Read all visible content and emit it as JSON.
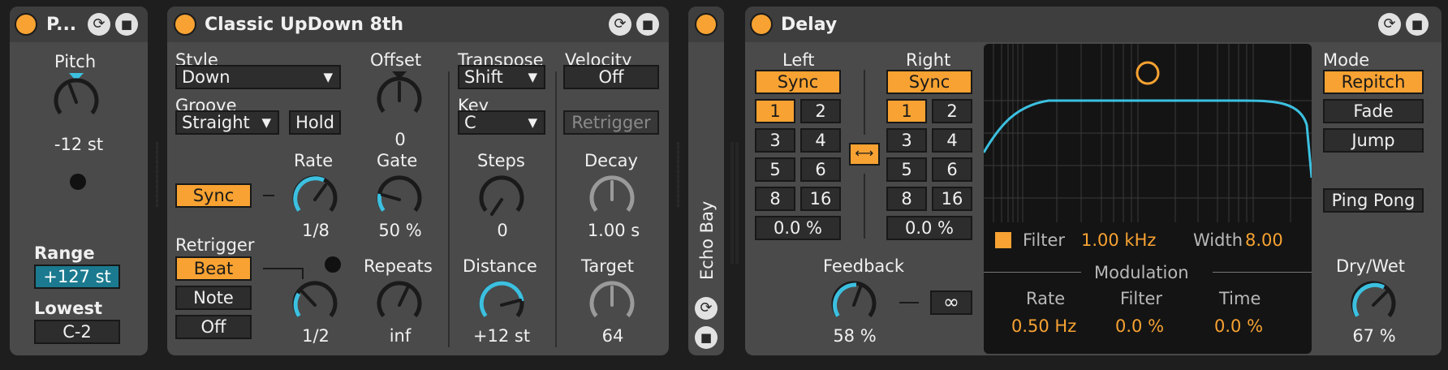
{
  "pitch_device": {
    "title": "P...",
    "pitch_label": "Pitch",
    "pitch_value": "-12 st",
    "range_label": "Range",
    "range_value": "+127 st",
    "lowest_label": "Lowest",
    "lowest_value": "C-2"
  },
  "arp_device": {
    "title": "Classic UpDown 8th",
    "style_label": "Style",
    "style_value": "Down",
    "groove_label": "Groove",
    "groove_value": "Straight",
    "hold_label": "Hold",
    "sync_label": "Sync",
    "rate_label": "Rate",
    "rate_value": "1/8",
    "offset_label": "Offset",
    "offset_value": "0",
    "gate_label": "Gate",
    "gate_value": "50 %",
    "retrigger_label": "Retrigger",
    "retrigger_options": [
      "Beat",
      "Note",
      "Off"
    ],
    "retrigger_rate_value": "1/2",
    "repeats_label": "Repeats",
    "repeats_value": "inf",
    "transpose_label": "Transpose",
    "transpose_value": "Shift",
    "key_label": "Key",
    "key_value": "C",
    "steps_label": "Steps",
    "steps_value": "0",
    "distance_label": "Distance",
    "distance_value": "+12 st",
    "velocity_label": "Velocity",
    "velocity_value": "Off",
    "vel_retrigger_label": "Retrigger",
    "decay_label": "Decay",
    "decay_value": "1.00 s",
    "target_label": "Target",
    "target_value": "64"
  },
  "echo_bay": {
    "title": "Echo Bay"
  },
  "delay_device": {
    "title": "Delay",
    "left_label": "Left",
    "right_label": "Right",
    "sync_label": "Sync",
    "division_buttons": [
      "1",
      "2",
      "3",
      "4",
      "5",
      "6",
      "8",
      "16"
    ],
    "left_offset": "0.0 %",
    "right_offset": "0.0 %",
    "feedback_label": "Feedback",
    "feedback_value": "58 %",
    "infinite_symbol": "∞",
    "filter_label": "Filter",
    "filter_value": "1.00 kHz",
    "width_label": "Width",
    "width_value": "8.00",
    "modulation_label": "Modulation",
    "mod_rate_label": "Rate",
    "mod_rate_value": "0.50 Hz",
    "mod_filter_label": "Filter",
    "mod_filter_value": "0.0 %",
    "mod_time_label": "Time",
    "mod_time_value": "0.0 %",
    "mode_label": "Mode",
    "mode_options": [
      "Repitch",
      "Fade",
      "Jump"
    ],
    "ping_pong_label": "Ping Pong",
    "drywet_label": "Dry/Wet",
    "drywet_value": "67 %"
  },
  "colors": {
    "accent": "#f7a232",
    "knob_arc": "#3cc0e0",
    "device_bg": "#4a4a4a"
  }
}
